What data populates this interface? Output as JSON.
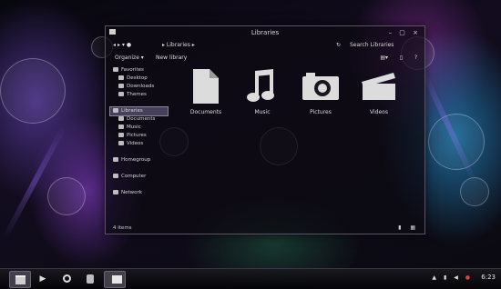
{
  "window": {
    "title": "Libraries",
    "controls": "– ▢ ×",
    "breadcrumb": "▸ Libraries ▸",
    "search_placeholder": "Search Libraries"
  },
  "toolbar": {
    "organize": "Organize ▾",
    "new_library": "New library"
  },
  "nav": {
    "favorites": [
      "Favorites",
      "Desktop",
      "Downloads",
      "Themes"
    ],
    "libraries": [
      "Libraries",
      "Documents",
      "Music",
      "Pictures",
      "Videos"
    ],
    "homegroup": "Homegroup",
    "computer": "Computer",
    "network": "Network"
  },
  "libraries": [
    {
      "label": "Documents",
      "icon": "document-icon"
    },
    {
      "label": "Music",
      "icon": "music-icon"
    },
    {
      "label": "Pictures",
      "icon": "camera-icon"
    },
    {
      "label": "Videos",
      "icon": "clapper-icon"
    }
  ],
  "status": "4 items",
  "taskbar": {
    "clock": "6:23"
  }
}
